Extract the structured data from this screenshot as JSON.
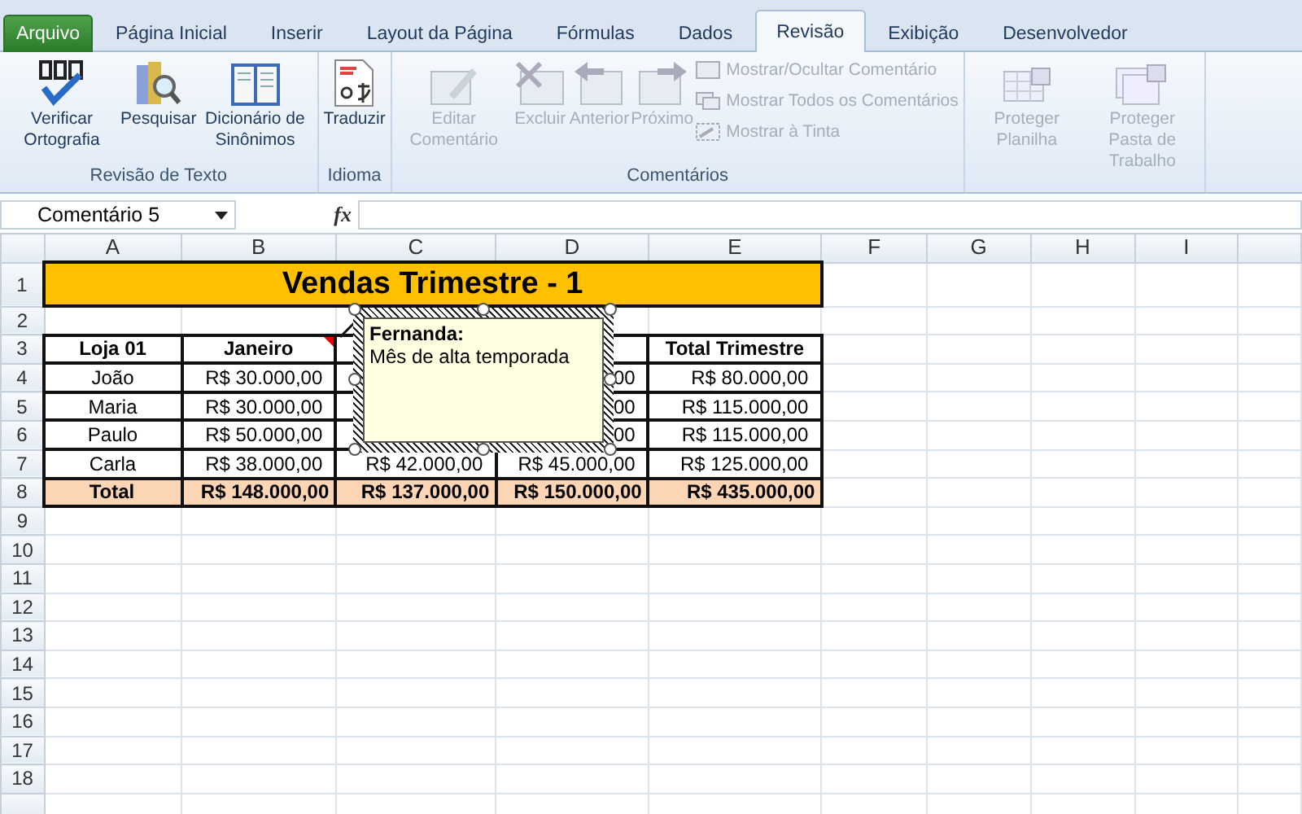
{
  "tabs": [
    {
      "label": "Arquivo",
      "kind": "file",
      "selected": false
    },
    {
      "label": "Página Inicial",
      "kind": "tab",
      "selected": false
    },
    {
      "label": "Inserir",
      "kind": "tab",
      "selected": false
    },
    {
      "label": "Layout da Página",
      "kind": "tab",
      "selected": false
    },
    {
      "label": "Fórmulas",
      "kind": "tab",
      "selected": false
    },
    {
      "label": "Dados",
      "kind": "tab",
      "selected": false
    },
    {
      "label": "Revisão",
      "kind": "tab",
      "selected": true
    },
    {
      "label": "Exibição",
      "kind": "tab",
      "selected": false
    },
    {
      "label": "Desenvolvedor",
      "kind": "tab",
      "selected": false
    }
  ],
  "ribbon": {
    "groups": [
      {
        "label": "Revisão de Texto",
        "buttons": [
          {
            "label": "Verificar Ortografia",
            "disabled": false
          },
          {
            "label": "Pesquisar",
            "disabled": false
          },
          {
            "label": "Dicionário de Sinônimos",
            "disabled": false
          }
        ]
      },
      {
        "label": "Idioma",
        "buttons": [
          {
            "label": "Traduzir",
            "disabled": false
          }
        ]
      },
      {
        "label": "Comentários",
        "buttons": [
          {
            "label": "Editar Comentário",
            "disabled": true
          },
          {
            "label": "Excluir",
            "disabled": true
          },
          {
            "label": "Anterior",
            "disabled": true
          },
          {
            "label": "Próximo",
            "disabled": true
          }
        ],
        "small_buttons": [
          {
            "label": "Mostrar/Ocultar Comentário",
            "disabled": true
          },
          {
            "label": "Mostrar Todos os Comentários",
            "disabled": true
          },
          {
            "label": "Mostrar à Tinta",
            "disabled": true
          }
        ]
      },
      {
        "buttons": [
          {
            "label": "Proteger Planilha",
            "disabled": true
          },
          {
            "label": "Proteger Pasta de Trabalho",
            "disabled": true
          }
        ]
      }
    ]
  },
  "formula_bar": {
    "name_box": "Comentário 5",
    "function_label": "fx"
  },
  "sheet": {
    "columns": [
      "A",
      "B",
      "C",
      "D",
      "E",
      "F",
      "G",
      "H",
      "I"
    ],
    "row_numbers": [
      "1",
      "2",
      "3",
      "4",
      "5",
      "6",
      "7",
      "8",
      "9",
      "10",
      "11",
      "12",
      "13",
      "14",
      "15",
      "16",
      "17",
      "18"
    ],
    "title": "Vendas Trimestre - 1",
    "rows": [
      {
        "kind": "header",
        "cells": [
          "Loja 01",
          "Janeiro",
          null,
          null,
          "Total Trimestre"
        ]
      },
      {
        "kind": "data",
        "cells": [
          "João",
          "R$ 30.000,00",
          null,
          "00",
          "R$ 80.000,00"
        ]
      },
      {
        "kind": "data",
        "cells": [
          "Maria",
          "R$ 30.000,00",
          null,
          "00",
          "R$ 115.000,00"
        ]
      },
      {
        "kind": "data",
        "cells": [
          "Paulo",
          "R$ 50.000,00",
          null,
          "00",
          "R$ 115.000,00"
        ]
      },
      {
        "kind": "data",
        "cells": [
          "Carla",
          "R$ 38.000,00",
          "R$ 42.000,00",
          "R$ 45.000,00",
          "R$ 125.000,00"
        ]
      },
      {
        "kind": "total",
        "cells": [
          "Total",
          "R$ 148.000,00",
          "R$ 137.000,00",
          "R$ 150.000,00",
          "R$ 435.000,00"
        ]
      }
    ],
    "comment": {
      "author": "Fernanda:",
      "text": "Mês de alta temporada"
    }
  }
}
